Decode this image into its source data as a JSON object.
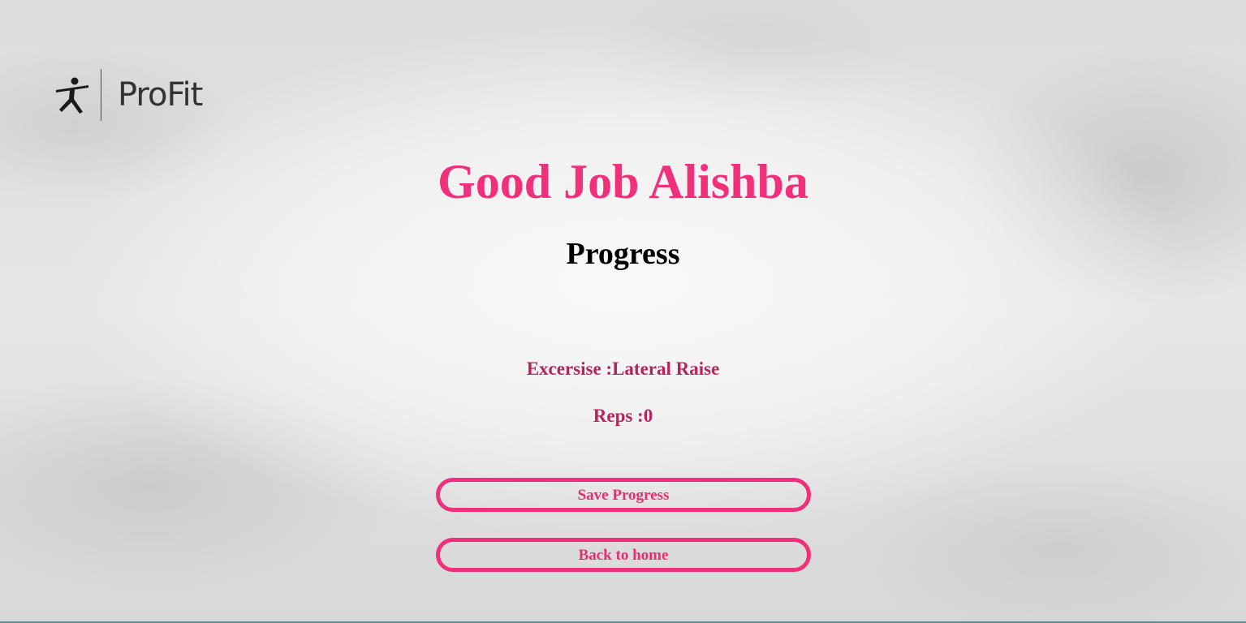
{
  "brand": {
    "name": "ProFit",
    "logo_icon": "yoga-figure-icon"
  },
  "result": {
    "greeting": "Good Job Alishba",
    "section_title": "Progress",
    "exercise_label": "Excersise :Lateral Raise",
    "reps_label": "Reps :0"
  },
  "actions": {
    "save_label": "Save Progress",
    "home_label": "Back to home"
  },
  "colors": {
    "accent": "#f0307a",
    "stat_text": "#b5245a",
    "title_text": "#000000"
  }
}
